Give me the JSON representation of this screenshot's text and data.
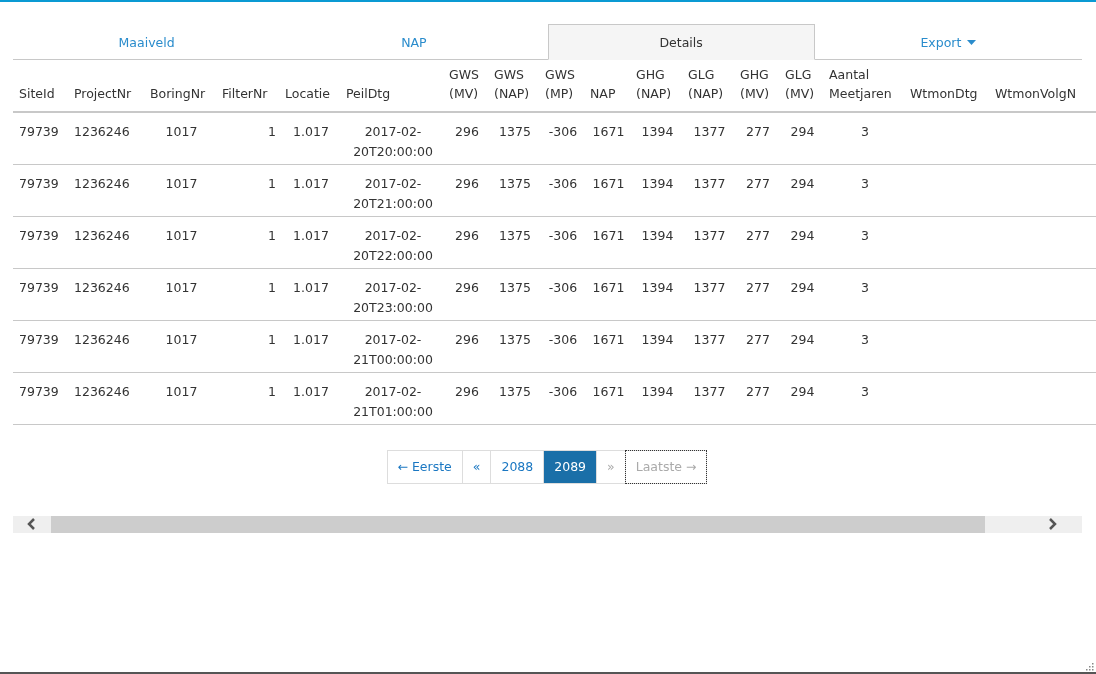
{
  "tabs": [
    {
      "label": "Maaiveld",
      "selected": false,
      "kind": "link"
    },
    {
      "label": "NAP",
      "selected": false,
      "kind": "link"
    },
    {
      "label": "Details",
      "selected": true,
      "kind": "link"
    },
    {
      "label": "Export",
      "selected": false,
      "kind": "dropdown"
    }
  ],
  "table": {
    "columns": [
      "SiteId",
      "ProjectNr",
      "BoringNr",
      "FilterNr",
      "Locatie",
      "PeilDtg",
      "GWS (MV)",
      "GWS (NAP)",
      "GWS (MP)",
      "NAP",
      "GHG (NAP)",
      "GLG (NAP)",
      "GHG (MV)",
      "GLG (MV)",
      "Aantal Meetjaren",
      "WtmonDtg",
      "WtmonVolgN"
    ],
    "rows": [
      [
        "79739",
        "1236246",
        "1017",
        "1",
        "1.017",
        "2017-02-20T20:00:00",
        "296",
        "1375",
        "-306",
        "1671",
        "1394",
        "1377",
        "277",
        "294",
        "3"
      ],
      [
        "79739",
        "1236246",
        "1017",
        "1",
        "1.017",
        "2017-02-20T21:00:00",
        "296",
        "1375",
        "-306",
        "1671",
        "1394",
        "1377",
        "277",
        "294",
        "3"
      ],
      [
        "79739",
        "1236246",
        "1017",
        "1",
        "1.017",
        "2017-02-20T22:00:00",
        "296",
        "1375",
        "-306",
        "1671",
        "1394",
        "1377",
        "277",
        "294",
        "3"
      ],
      [
        "79739",
        "1236246",
        "1017",
        "1",
        "1.017",
        "2017-02-20T23:00:00",
        "296",
        "1375",
        "-306",
        "1671",
        "1394",
        "1377",
        "277",
        "294",
        "3"
      ],
      [
        "79739",
        "1236246",
        "1017",
        "1",
        "1.017",
        "2017-02-21T00:00:00",
        "296",
        "1375",
        "-306",
        "1671",
        "1394",
        "1377",
        "277",
        "294",
        "3"
      ],
      [
        "79739",
        "1236246",
        "1017",
        "1",
        "1.017",
        "2017-02-21T01:00:00",
        "296",
        "1375",
        "-306",
        "1671",
        "1394",
        "1377",
        "277",
        "294",
        "3"
      ]
    ]
  },
  "pagination": [
    {
      "label": "← Eerste",
      "selected": false,
      "disabled": false,
      "focused": false
    },
    {
      "label": "«",
      "selected": false,
      "disabled": false,
      "focused": false
    },
    {
      "label": "2088",
      "selected": false,
      "disabled": false,
      "focused": false
    },
    {
      "label": "2089",
      "selected": true,
      "disabled": false,
      "focused": false
    },
    {
      "label": "»",
      "selected": false,
      "disabled": true,
      "focused": false
    },
    {
      "label": "Laatste →",
      "selected": false,
      "disabled": true,
      "focused": true
    }
  ]
}
